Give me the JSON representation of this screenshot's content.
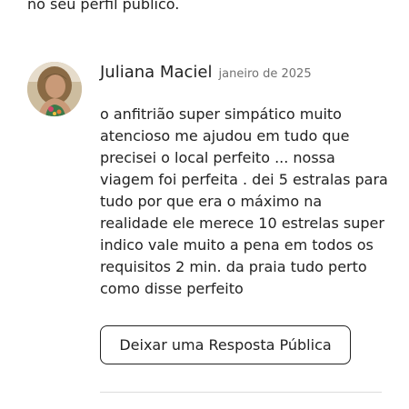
{
  "intro": {
    "trailing_text": "no seu perfil público."
  },
  "review": {
    "reviewer_name": "Juliana Maciel",
    "date": "janeiro de 2025",
    "body": "o anfitrião super simpático muito atencioso me ajudou em tudo que precisei o local perfeito ... nossa viagem foi perfeita . dei 5 estralas para tudo por que era o máximo na realidade ele merece 10 estrelas super indico vale muito a pena em todos os requisitos 2 min. da praia tudo perto como disse perfeito"
  },
  "actions": {
    "reply_label": "Deixar uma Resposta Pública"
  }
}
